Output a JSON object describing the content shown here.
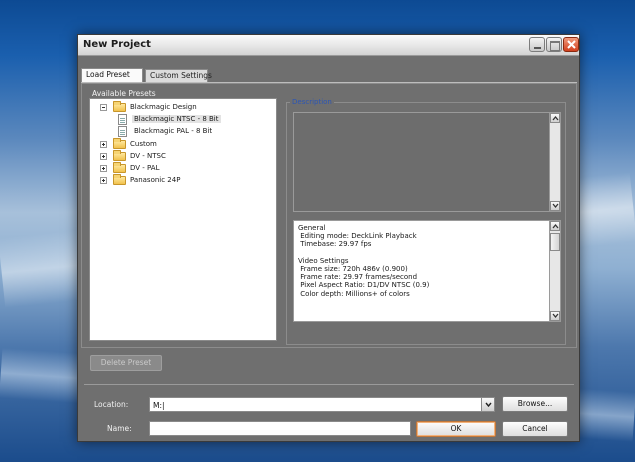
{
  "window": {
    "title": "New Project"
  },
  "tabs": [
    {
      "label": "Load Preset",
      "active": true
    },
    {
      "label": "Custom Settings",
      "active": false
    }
  ],
  "presets": {
    "section_label": "Available Presets",
    "tree": [
      {
        "label": "Blackmagic Design",
        "type": "folder",
        "expanded": true,
        "level": 0
      },
      {
        "label": "Blackmagic NTSC - 8 Bit",
        "type": "file",
        "selected": true,
        "level": 1
      },
      {
        "label": "Blackmagic PAL - 8 Bit",
        "type": "file",
        "selected": false,
        "level": 1
      },
      {
        "label": "Custom",
        "type": "folder",
        "expanded": false,
        "level": 0
      },
      {
        "label": "DV - NTSC",
        "type": "folder",
        "expanded": false,
        "level": 0
      },
      {
        "label": "DV - PAL",
        "type": "folder",
        "expanded": false,
        "level": 0
      },
      {
        "label": "Panasonic 24P",
        "type": "folder",
        "expanded": false,
        "level": 0
      }
    ]
  },
  "description": {
    "legend": "Description",
    "text": ""
  },
  "info": {
    "text": "General\n Editing mode: DeckLink Playback\n Timebase: 29.97 fps\n\nVideo Settings\n Frame size: 720h 486v (0.900)\n Frame rate: 29.97 frames/second\n Pixel Aspect Ratio: D1/DV NTSC (0.9)\n Color depth: Millions+ of colors"
  },
  "buttons": {
    "delete_preset": "Delete Preset",
    "browse": "Browse...",
    "ok": "OK",
    "cancel": "Cancel"
  },
  "location": {
    "label": "Location:",
    "value": "M:|"
  },
  "name": {
    "label": "Name:",
    "value": ""
  },
  "colors": {
    "window_body": "#6f6f6f",
    "description_legend": "#2d56b3",
    "close_button": "#d2401d"
  }
}
